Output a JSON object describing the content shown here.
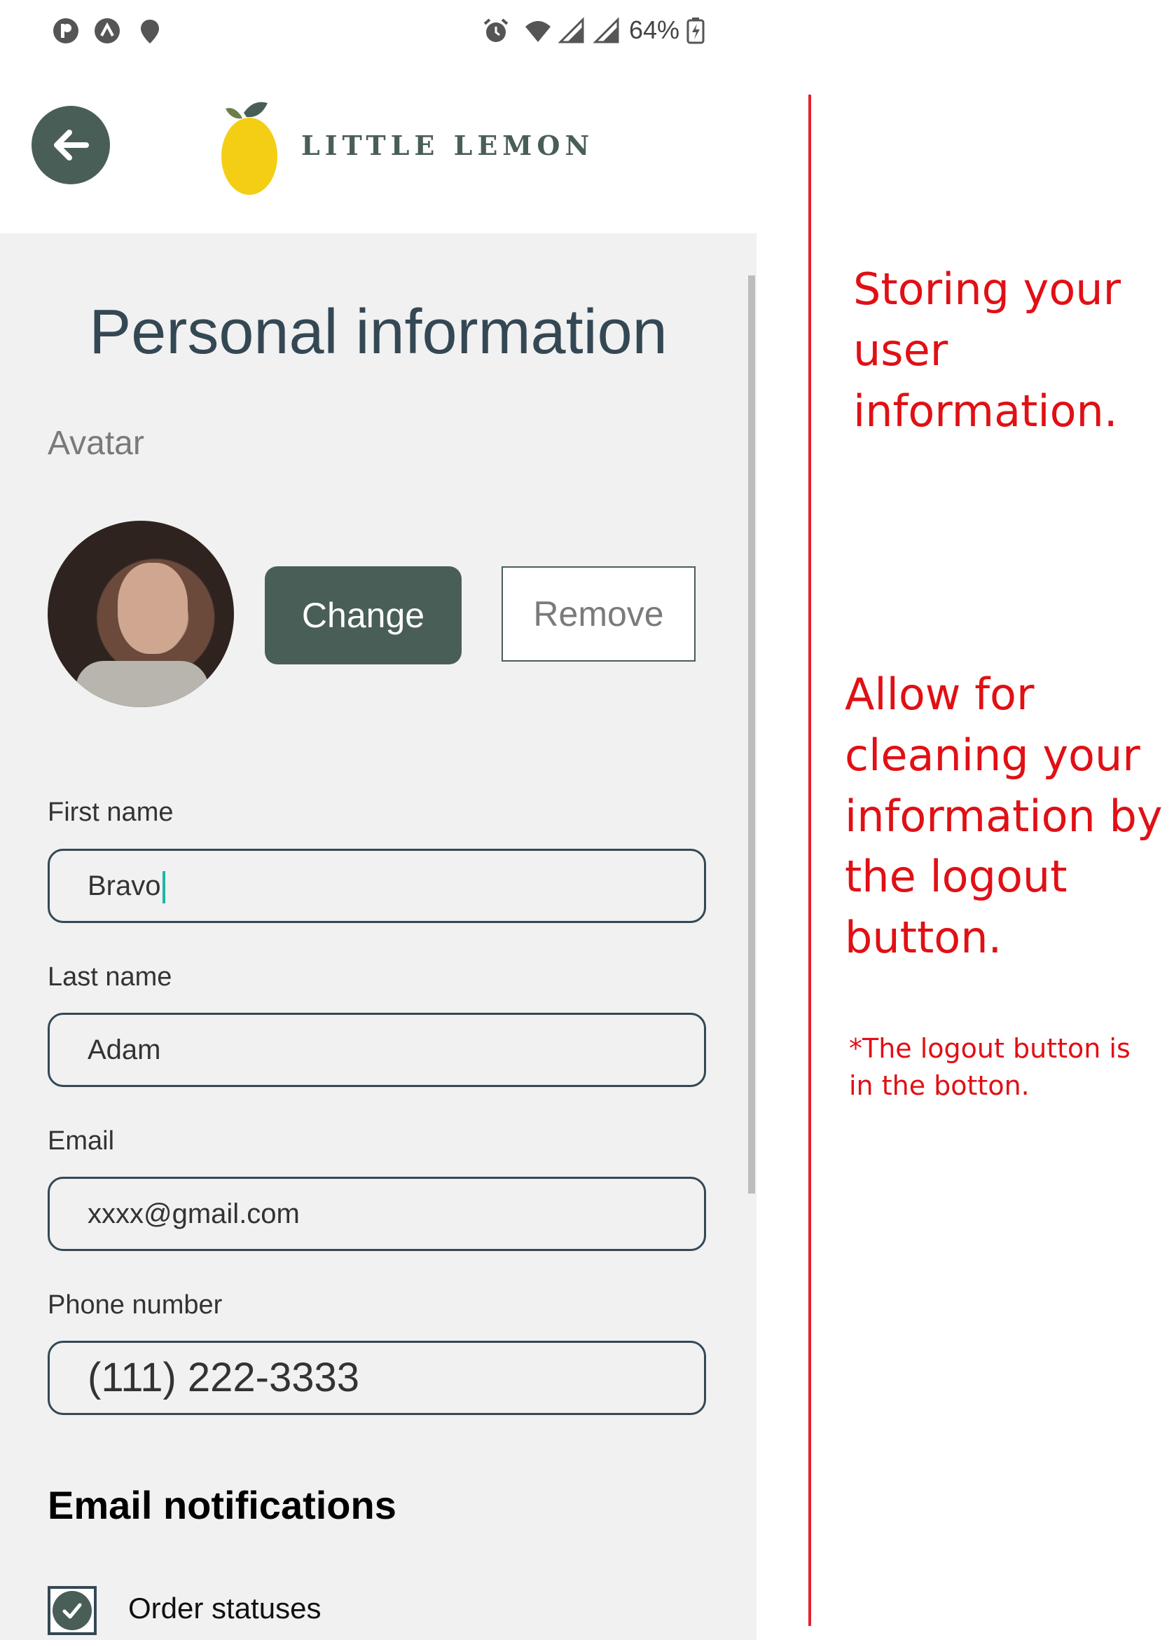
{
  "status_bar": {
    "battery": "64%",
    "icons": [
      "app-p-icon",
      "app-caret-icon",
      "location-icon",
      "alarm-icon",
      "wifi-icon",
      "signal-icon",
      "signal-icon",
      "battery-charging-icon"
    ]
  },
  "header": {
    "back_icon": "arrow-left-icon",
    "logo_text": "LITTLE LEMON"
  },
  "page": {
    "title": "Personal information",
    "avatar_label": "Avatar",
    "change_label": "Change",
    "remove_label": "Remove"
  },
  "fields": {
    "first_name": {
      "label": "First name",
      "value": "Bravo"
    },
    "last_name": {
      "label": "Last name",
      "value": "Adam"
    },
    "email": {
      "label": "Email",
      "value": "xxxx@gmail.com"
    },
    "phone": {
      "label": "Phone number",
      "value": "(111) 222-3333"
    }
  },
  "notifications": {
    "heading": "Email notifications",
    "items": [
      {
        "label": "Order statuses",
        "checked": true
      }
    ]
  },
  "annotations": {
    "note1": "Storing your user information.",
    "note2": "Allow for cleaning your information by the logout button.",
    "note3": "*The logout button is in the botton."
  },
  "colors": {
    "primary": "#495e57",
    "annotation": "#e01015",
    "lemon": "#f4ce14"
  }
}
